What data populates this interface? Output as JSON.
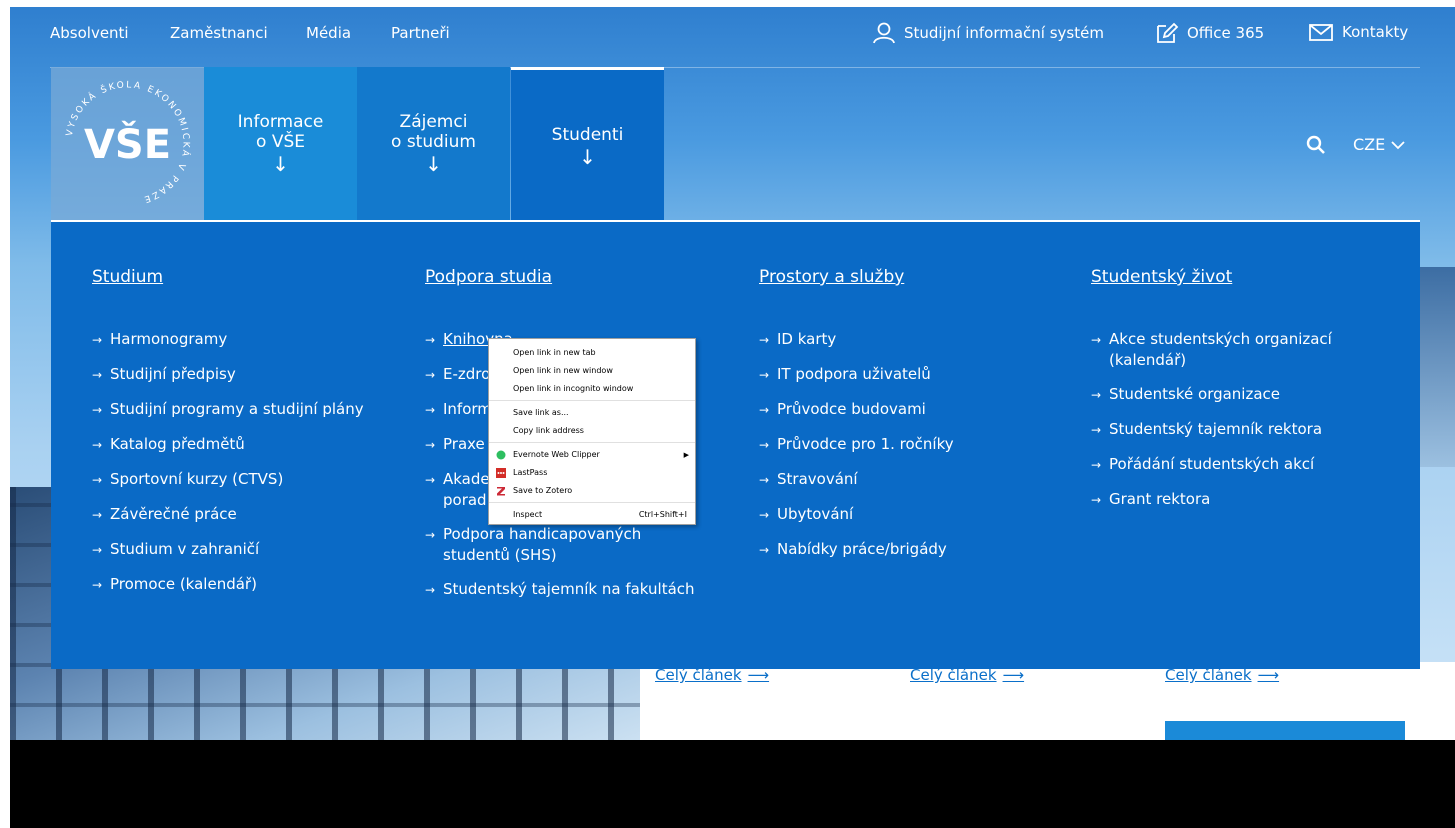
{
  "colors": {
    "menu_bg": "#0a6ac6",
    "tab1_bg": "#1a8cd8",
    "tab2_bg": "#1379cc",
    "link": "#0a6fc9"
  },
  "top_links": [
    "Absolventi",
    "Zaměstnanci",
    "Média",
    "Partneři"
  ],
  "top_right": {
    "sis": {
      "label": "Studijní informační systém",
      "icon": "user-icon"
    },
    "office": {
      "label": "Office 365",
      "icon": "edit-icon"
    },
    "contacts": {
      "label": "Kontakty",
      "icon": "mail-icon"
    }
  },
  "logo": {
    "wordmark": "VŠE",
    "ring": "VYSOKÁ ŠKOLA EKONOMICKÁ V PRAZE"
  },
  "nav": {
    "tab1": {
      "line1": "Informace",
      "line2": "o VŠE",
      "arrow": "↓"
    },
    "tab2": {
      "line1": "Zájemci",
      "line2": "o studium",
      "arrow": "↓"
    },
    "tab3": {
      "line1": "Studenti",
      "arrow": "↓"
    },
    "lang": "CZE"
  },
  "menu": {
    "studium": {
      "title": "Studium",
      "items": [
        "Harmonogramy",
        "Studijní předpisy",
        "Studijní programy a studijní plány",
        "Katalog předmětů",
        "Sportovní kurzy (CTVS)",
        "Závěrečné práce",
        "Studium v zahraničí",
        "Promoce (kalendář)"
      ]
    },
    "podpora": {
      "title": "Podpora studia",
      "items": [
        "Knihovna",
        "E-zdro",
        "Inform",
        "Praxe",
        "Akade",
        "porad",
        "Podpora handicapovaných",
        "studentů (SHS)",
        "Studentský tajemník na fakultách"
      ]
    },
    "prostory": {
      "title": "Prostory a služby",
      "items": [
        "ID karty",
        "IT podpora uživatelů",
        "Průvodce budovami",
        "Průvodce pro 1. ročníky",
        "Stravování",
        "Ubytování",
        "Nabídky práce/brigády"
      ]
    },
    "zivot": {
      "title": "Studentský život",
      "items": [
        "Akce studentských organizací",
        "(kalendář)",
        "Studentské organizace",
        "Studentský tajemník rektora",
        "Pořádání studentských akcí",
        "Grant rektora"
      ]
    }
  },
  "arrow_glyph": "→",
  "context_menu": {
    "items": [
      "Open link in new tab",
      "Open link in new window",
      "Open link in incognito window",
      "Save link as...",
      "Copy link address",
      "Evernote Web Clipper",
      "LastPass",
      "Save to Zotero",
      "Inspect"
    ],
    "inspect_shortcut": "Ctrl+Shift+I"
  },
  "news": {
    "link": "Celý článek",
    "arrow": "⟶"
  }
}
